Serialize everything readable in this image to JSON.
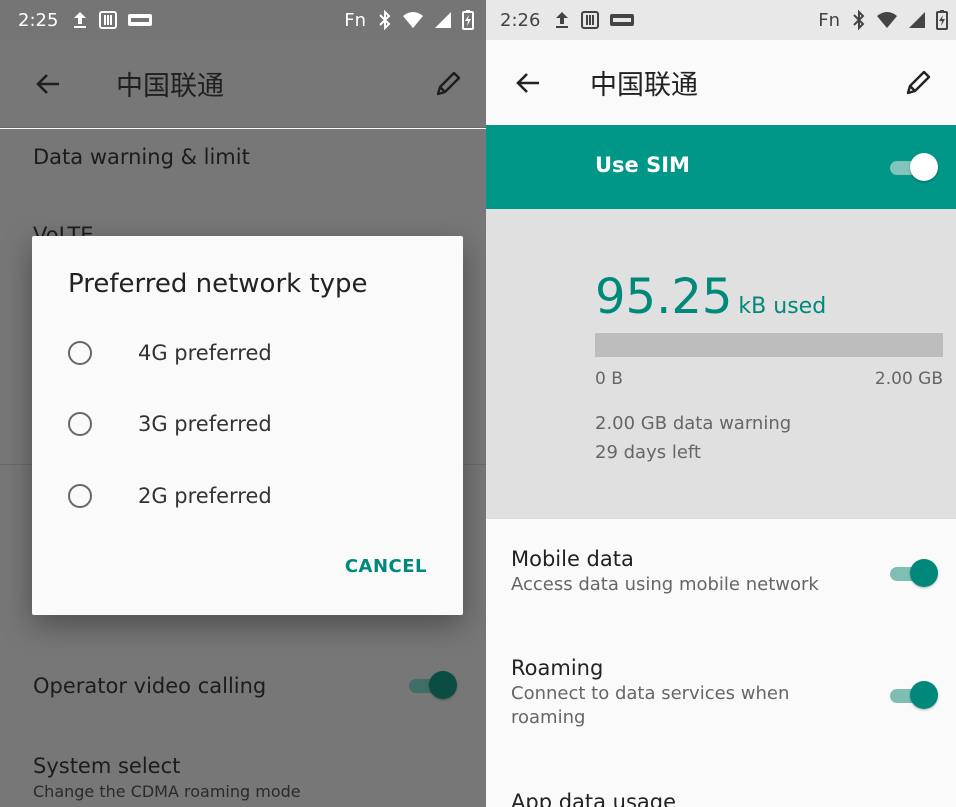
{
  "left": {
    "status": {
      "time": "2:25",
      "fn": "Fn"
    },
    "appbar": {
      "title": "中国联通"
    },
    "items": {
      "data_warning": "Data warning & limit",
      "volte": "VoLTE",
      "operator_video": "Operator video calling",
      "system_select": "System select",
      "system_select_sub": "Change the CDMA roaming mode"
    },
    "dialog": {
      "title": "Preferred network type",
      "options": [
        "4G preferred",
        "3G preferred",
        "2G preferred"
      ],
      "cancel": "CANCEL"
    }
  },
  "right": {
    "status": {
      "time": "2:26",
      "fn": "Fn"
    },
    "appbar": {
      "title": "中国联通"
    },
    "sim": {
      "label": "Use SIM",
      "on": true
    },
    "usage": {
      "amount": "95.25",
      "unit": "kB used",
      "min": "0 B",
      "max": "2.00 GB",
      "fill_fraction": 0.0,
      "warning": "2.00 GB data warning",
      "days_left": "29 days left"
    },
    "mobile_data": {
      "title": "Mobile data",
      "subtitle": "Access data using mobile network",
      "on": true
    },
    "roaming": {
      "title": "Roaming",
      "subtitle": "Connect to data services when roaming",
      "on": true
    },
    "app_usage": {
      "title": "App data usage"
    }
  },
  "colors": {
    "accent": "#00897b",
    "sim_bar": "#009688"
  },
  "icons": [
    "upload-icon",
    "sim-card-icon",
    "volte-icon",
    "bluetooth-icon",
    "wifi-icon",
    "signal-icon",
    "battery-charging-icon",
    "back-arrow-icon",
    "pencil-icon"
  ]
}
